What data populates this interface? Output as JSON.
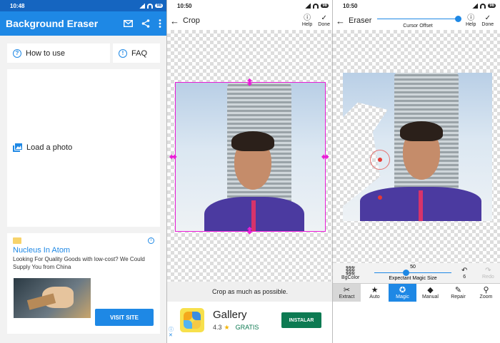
{
  "panel1": {
    "status_time": "10:48",
    "battery": "98",
    "app_title": "Background Eraser",
    "icons": [
      "mail-icon",
      "share-icon",
      "more-vert-icon"
    ],
    "how_to_use": "How to use",
    "faq": "FAQ",
    "load_photo": "Load a photo",
    "ad": {
      "title": "Nucleus In Atom",
      "description": "Looking For Quality Goods with low-cost? We Could Supply You from China",
      "cta": "VISIT SITE"
    }
  },
  "panel2": {
    "status_time": "10:50",
    "battery": "98",
    "title": "Crop",
    "help": "Help",
    "done": "Done",
    "hint": "Crop as much as possible.",
    "ad": {
      "app_name": "Gallery",
      "rating": "4.3",
      "price": "GRATIS",
      "install": "INSTALAR"
    }
  },
  "panel3": {
    "status_time": "10:50",
    "battery": "98",
    "title": "Eraser",
    "cursor_offset": "Cursor Offset",
    "help": "Help",
    "done": "Done",
    "bgcolor": "BgColor",
    "magic_size_value": "50",
    "magic_size_label": "Expectant Magic Size",
    "undo_count": "6",
    "redo_label": "Redo",
    "tabs": [
      "Extract",
      "Auto",
      "Magic",
      "Manual",
      "Repair",
      "Zoom"
    ]
  },
  "colors": {
    "primary": "#1e88e5",
    "accent": "#e91ed6",
    "install_green": "#0d7a52"
  }
}
